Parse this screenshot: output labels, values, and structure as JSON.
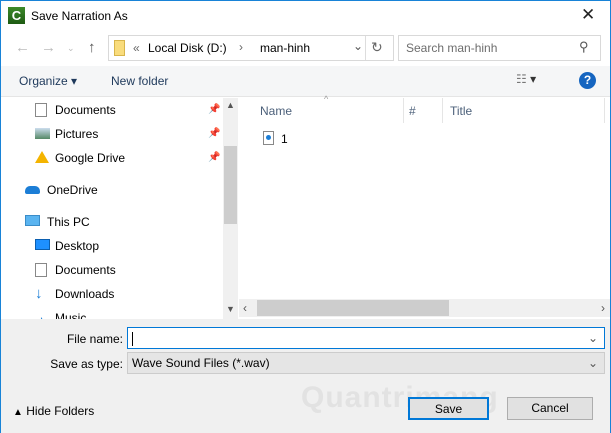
{
  "window": {
    "title": "Save Narration As",
    "app_icon_letter": "C"
  },
  "address": {
    "overflow": "«",
    "segments": [
      "Local Disk (D:)",
      "man-hinh"
    ],
    "separator": "›"
  },
  "search": {
    "placeholder": "Search man-hinh"
  },
  "toolbar": {
    "organize": "Organize",
    "new_folder": "New folder",
    "help": "?"
  },
  "sidebar": {
    "items": [
      {
        "label": "Documents",
        "icon": "documents-icon",
        "pinned": true
      },
      {
        "label": "Pictures",
        "icon": "pictures-icon",
        "pinned": true
      },
      {
        "label": "Google Drive",
        "icon": "google-drive-icon",
        "pinned": true
      },
      {
        "label": "OneDrive",
        "icon": "onedrive-icon"
      },
      {
        "label": "This PC",
        "icon": "this-pc-icon"
      },
      {
        "label": "Desktop",
        "icon": "desktop-icon"
      },
      {
        "label": "Documents",
        "icon": "documents-icon"
      },
      {
        "label": "Downloads",
        "icon": "downloads-icon"
      },
      {
        "label": "Music",
        "icon": "music-icon"
      }
    ]
  },
  "columns": [
    "Name",
    "#",
    "Title"
  ],
  "files": [
    {
      "name": "1",
      "icon": "audio-file-icon"
    }
  ],
  "form": {
    "file_name_label": "File name:",
    "file_name_value": "",
    "save_type_label": "Save as type:",
    "save_type_value": "Wave Sound Files (*.wav)"
  },
  "footer": {
    "hide_folders": "Hide Folders",
    "save": "Save",
    "cancel": "Cancel"
  },
  "watermark": "Quantrimang",
  "colors": {
    "accent": "#0078d7",
    "border": "#1883d7"
  }
}
